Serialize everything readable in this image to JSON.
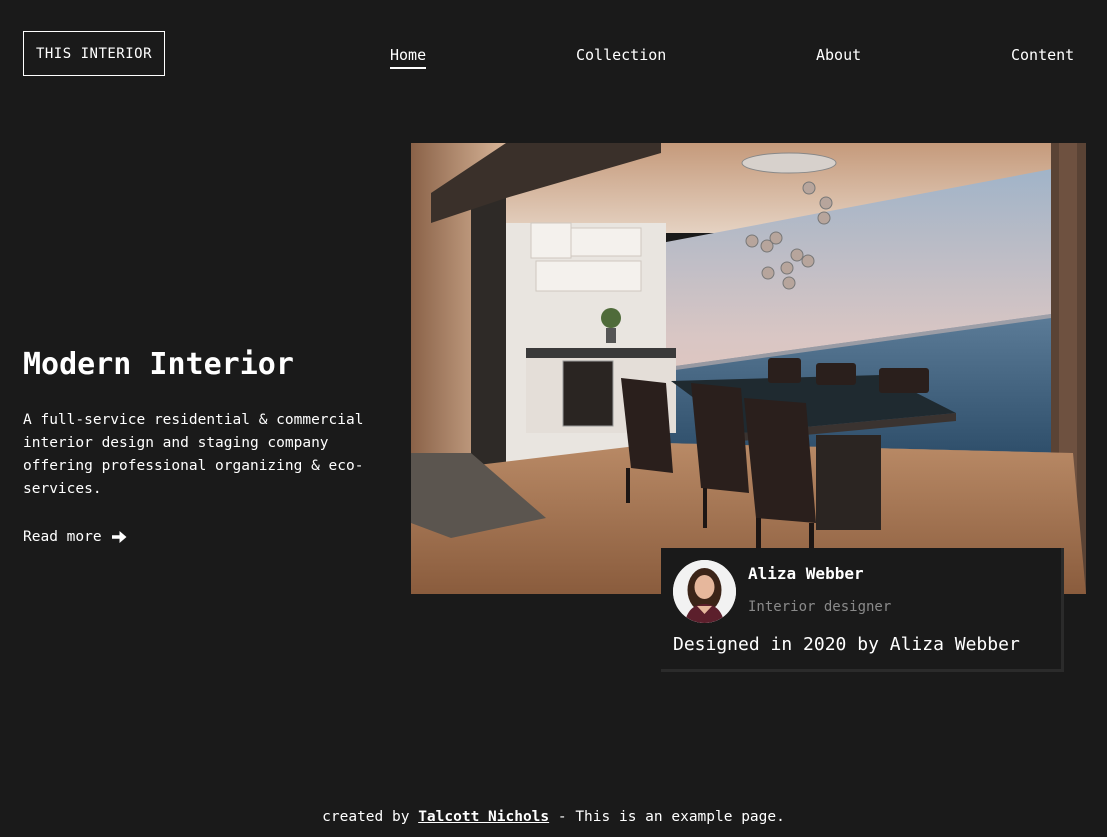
{
  "header": {
    "logo": "THIS INTERIOR",
    "nav": [
      {
        "label": "Home",
        "active": true
      },
      {
        "label": "Collection",
        "active": false
      },
      {
        "label": "About",
        "active": false
      },
      {
        "label": "Content",
        "active": false
      }
    ]
  },
  "hero": {
    "title": "Modern Interior",
    "description": "A full-service residential & commercial interior design and staging company offering professional organizing & eco-services.",
    "read_more_label": "Read more",
    "read_more_icon": "arrow-right-icon",
    "image_subject": "dining-room-ocean-view-photo"
  },
  "designer_card": {
    "name": "Aliza Webber",
    "role": "Interior designer",
    "credit": "Designed in 2020 by Aliza Webber"
  },
  "footer": {
    "prefix": "created by ",
    "author": "Talcott Nichols",
    "suffix": " - This is an example page."
  },
  "colors": {
    "background": "#1a1a1a",
    "text": "#ffffff",
    "muted_text": "#8a8a8a"
  }
}
